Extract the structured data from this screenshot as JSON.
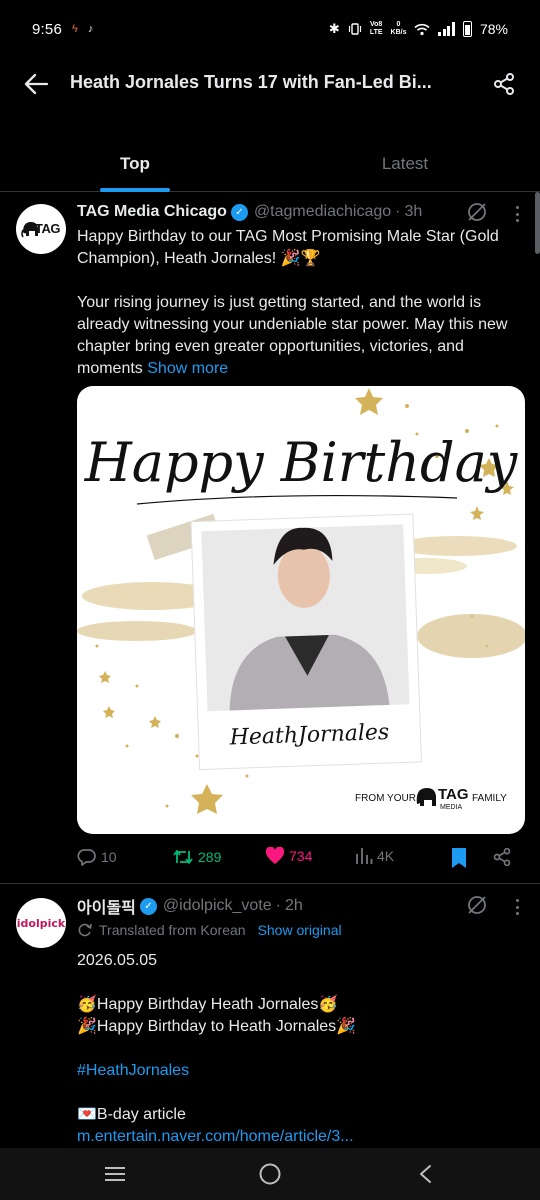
{
  "status_bar": {
    "time": "9:56",
    "network_line1": "Vo8",
    "network_line2": "LTE",
    "speed_line1": "0",
    "speed_line2": "KB/s",
    "battery": "78%"
  },
  "header": {
    "title": "Heath Jornales Turns 17 with Fan-Led Bi..."
  },
  "tabs": [
    {
      "label": "Top",
      "active": true
    },
    {
      "label": "Latest",
      "active": false
    }
  ],
  "post1": {
    "avatar_text": "TAG",
    "author": "TAG Media Chicago",
    "handle": "@tagmediachicago",
    "separator": "·",
    "time": "3h",
    "text_p1": "Happy Birthday to our TAG Most Promising Male Star (Gold Champion), Heath Jornales! 🎉🏆",
    "text_p2": "Your rising journey is just getting started, and the world is already witnessing your undeniable star power. May this new chapter bring even greater opportunities, victories, and moments",
    "show_more": "Show more",
    "image": {
      "headline": "Happy Birthday",
      "caption": "HeathJornales",
      "footer_left": "FROM YOUR",
      "footer_brand": "TAG",
      "footer_brand_sub": "MEDIA",
      "footer_right": "FAMILY"
    },
    "stats": {
      "replies": "10",
      "reposts": "289",
      "likes": "734",
      "views": "4K"
    }
  },
  "post2": {
    "avatar_text": "idolpick",
    "author": "아이돌픽",
    "handle": "@idolpick_vote",
    "separator": "·",
    "time": "2h",
    "translated_label": "Translated from Korean",
    "show_original": "Show original",
    "line_date": "2026.05.05",
    "line_bday1": "🥳Happy Birthday Heath Jornales🥳",
    "line_bday2": "🎉Happy Birthday to Heath Jornales🎉",
    "hashtag": "#HeathJornales",
    "article_label": "💌B-day article",
    "article_link": "m.entertain.naver.com/home/article/3..."
  },
  "colors": {
    "accent": "#1d9bf0",
    "repost": "#00ba7c",
    "like": "#f91880",
    "muted": "#71767b",
    "gold": "#d4b25a"
  },
  "icons": {
    "back": "arrow-left-icon",
    "share": "share-icon",
    "grok": "grok-icon",
    "more": "more-vertical-icon",
    "reply": "reply-icon",
    "repost": "repost-icon",
    "like": "heart-icon",
    "views": "views-icon",
    "bookmark": "bookmark-icon",
    "translate": "translate-icon",
    "nav_recents": "recents-icon",
    "nav_home": "home-icon",
    "nav_back": "nav-back-icon"
  }
}
